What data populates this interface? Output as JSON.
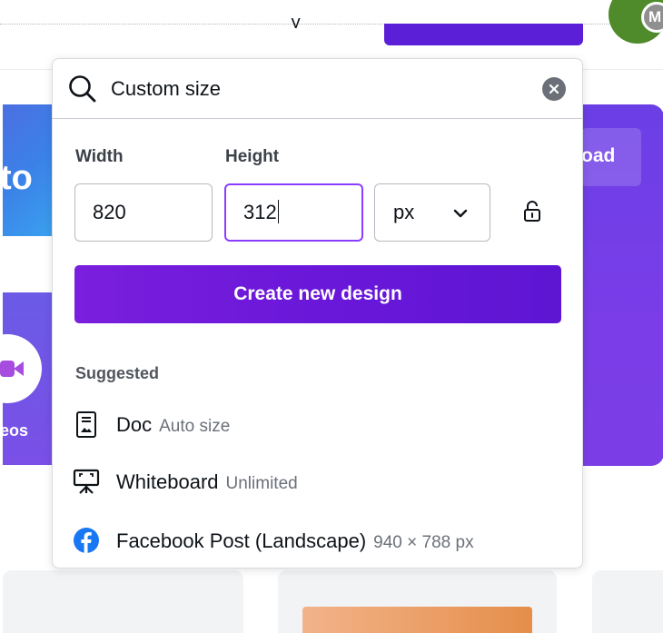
{
  "background": {
    "top_cut_text": "_ y",
    "avatar_initial": "M",
    "blue_card_text": "to",
    "videos_label": "eos",
    "right_button_text": "oad"
  },
  "search": {
    "value": "Custom size",
    "icon": "search-icon",
    "clear_icon": "close-icon"
  },
  "size": {
    "width_label": "Width",
    "height_label": "Height",
    "width_value": "820",
    "height_value": "312",
    "unit": "px",
    "lock_icon": "unlock-icon"
  },
  "create_button_label": "Create new design",
  "suggested": {
    "label": "Suggested",
    "items": [
      {
        "name": "Doc",
        "meta": "Auto size",
        "icon": "doc-icon"
      },
      {
        "name": "Whiteboard",
        "meta": "Unlimited",
        "icon": "whiteboard-icon"
      },
      {
        "name": "Facebook Post (Landscape)",
        "meta": "940 × 788 px",
        "icon": "facebook-icon"
      }
    ]
  },
  "colors": {
    "accent": "#8b3dff",
    "button": "#6a17d9",
    "facebook": "#1877f2"
  }
}
